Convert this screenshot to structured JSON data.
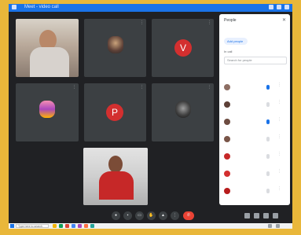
{
  "window": {
    "title": "Meet - video call"
  },
  "tiles": [
    {
      "name": "",
      "kind": "photo"
    },
    {
      "name": "",
      "kind": "image"
    },
    {
      "name": "",
      "kind": "letter",
      "letter": "V"
    },
    {
      "name": "",
      "kind": "image"
    },
    {
      "name": "",
      "kind": "letter",
      "letter": "P"
    },
    {
      "name": "",
      "kind": "image"
    },
    {
      "name": "",
      "kind": "photo"
    }
  ],
  "panel": {
    "title": "People",
    "add_label": "Add people",
    "search_placeholder": "Search for people",
    "section_label": "In call",
    "participants": [
      {
        "name": "",
        "color": "#8d6e63",
        "mic": "on"
      },
      {
        "name": "",
        "color": "#5d4037",
        "mic": "off"
      },
      {
        "name": "",
        "color": "#6d4c41",
        "mic": "on"
      },
      {
        "name": "",
        "color": "#795548",
        "mic": "off"
      },
      {
        "name": "",
        "color": "#c62828",
        "mic": "off"
      },
      {
        "name": "",
        "color": "#d32f2f",
        "mic": "off"
      },
      {
        "name": "",
        "color": "#b71c1c",
        "mic": "off"
      }
    ]
  },
  "controls": {
    "meeting_info": ""
  },
  "taskbar": {
    "search_placeholder": "Type here to search"
  },
  "colors": {
    "accent": "#1a73e8",
    "end_call": "#ea4335",
    "avatar_red": "#d32f2f",
    "frame_bg": "#e9b73a"
  },
  "icons": [
    "mic-icon",
    "camera-icon",
    "captions-icon",
    "hand-icon",
    "present-icon",
    "more-icon",
    "end-call-icon",
    "info-icon",
    "people-icon",
    "chat-icon",
    "activities-icon"
  ]
}
